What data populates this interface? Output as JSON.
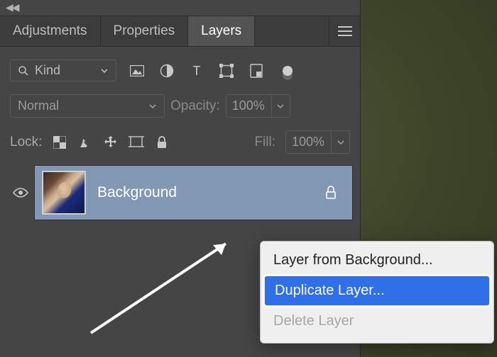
{
  "tabs": {
    "adjustments": "Adjustments",
    "properties": "Properties",
    "layers": "Layers"
  },
  "filter": {
    "kind_label": "Kind"
  },
  "blend": {
    "mode": "Normal",
    "opacity_label": "Opacity:",
    "opacity_value": "100%"
  },
  "lock": {
    "label": "Lock:",
    "fill_label": "Fill:",
    "fill_value": "100%"
  },
  "layer": {
    "name": "Background"
  },
  "context_menu": {
    "layer_from_bg": "Layer from Background...",
    "duplicate": "Duplicate Layer...",
    "delete": "Delete Layer"
  }
}
